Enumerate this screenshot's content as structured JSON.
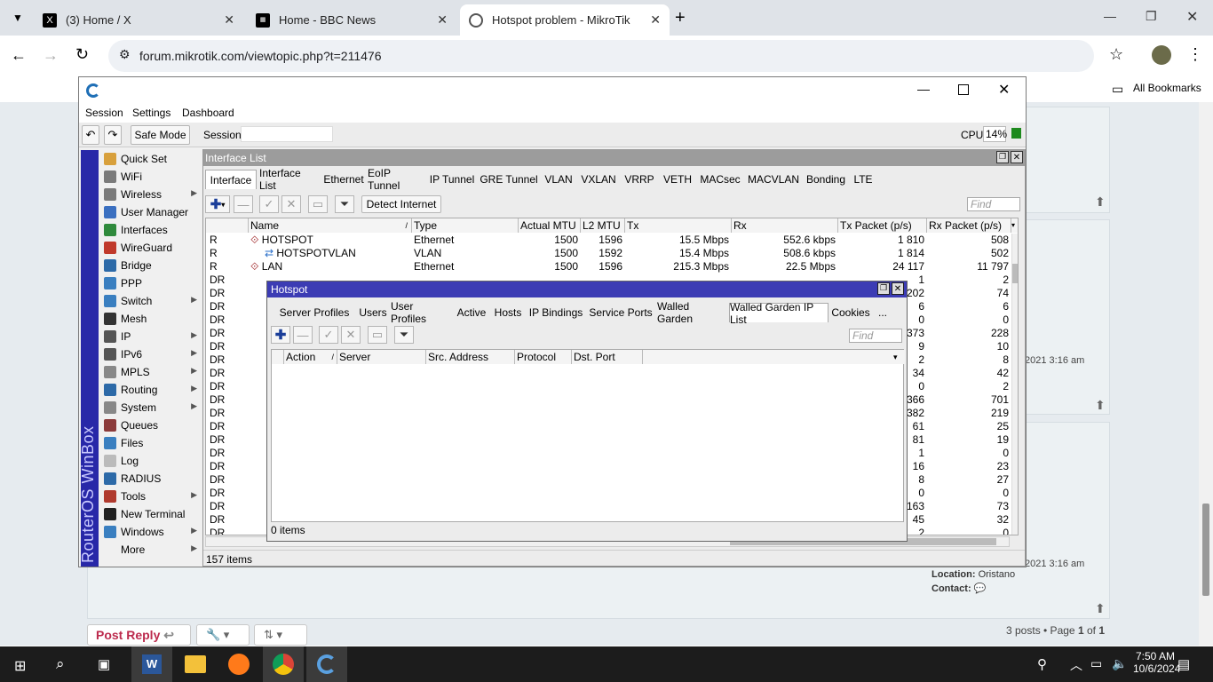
{
  "browser": {
    "tabs": [
      {
        "label": "(3) Home / X"
      },
      {
        "label": "Home - BBC News"
      },
      {
        "label": "Hotspot problem - MikroTik"
      }
    ],
    "url": "forum.mikrotik.com/viewtopic.php?t=211476",
    "all_bookmarks": "All Bookmarks"
  },
  "forum": {
    "timestamp1": "2021 3:16 am",
    "timestamp2": "2021 3:16 am",
    "location_label": "Location:",
    "location_value": "Oristano",
    "contact_label": "Contact:",
    "post_reply": "Post Reply",
    "pagination_prefix": "3 posts • Page",
    "page_current": "1",
    "page_of": "of",
    "page_total": "1"
  },
  "winbox": {
    "menu": [
      "Session",
      "Settings",
      "Dashboard"
    ],
    "safe_mode": "Safe Mode",
    "session_label": "Session:",
    "cpu_label": "CPU:",
    "cpu_value": "14%",
    "brand": "RouterOS WinBox",
    "sidebar": [
      {
        "label": "Quick Set",
        "arrow": false,
        "color": "#d8a03c"
      },
      {
        "label": "WiFi",
        "arrow": false,
        "color": "#7a7a7a"
      },
      {
        "label": "Wireless",
        "arrow": true,
        "color": "#7a7a7a"
      },
      {
        "label": "User Manager",
        "arrow": false,
        "color": "#3a6fc0"
      },
      {
        "label": "Interfaces",
        "arrow": false,
        "color": "#2f8a3c"
      },
      {
        "label": "WireGuard",
        "arrow": false,
        "color": "#c0392b"
      },
      {
        "label": "Bridge",
        "arrow": false,
        "color": "#2d6aa8"
      },
      {
        "label": "PPP",
        "arrow": false,
        "color": "#3a7fc0"
      },
      {
        "label": "Switch",
        "arrow": true,
        "color": "#3a7fc0"
      },
      {
        "label": "Mesh",
        "arrow": false,
        "color": "#333"
      },
      {
        "label": "IP",
        "arrow": true,
        "color": "#555"
      },
      {
        "label": "IPv6",
        "arrow": true,
        "color": "#555"
      },
      {
        "label": "MPLS",
        "arrow": true,
        "color": "#888"
      },
      {
        "label": "Routing",
        "arrow": true,
        "color": "#2d6aa8"
      },
      {
        "label": "System",
        "arrow": true,
        "color": "#888"
      },
      {
        "label": "Queues",
        "arrow": false,
        "color": "#8b3a3a"
      },
      {
        "label": "Files",
        "arrow": false,
        "color": "#3a7fc0"
      },
      {
        "label": "Log",
        "arrow": false,
        "color": "#bbb"
      },
      {
        "label": "RADIUS",
        "arrow": false,
        "color": "#2d6aa8"
      },
      {
        "label": "Tools",
        "arrow": true,
        "color": "#b03a2e"
      },
      {
        "label": "New Terminal",
        "arrow": false,
        "color": "#222"
      },
      {
        "label": "Windows",
        "arrow": true,
        "color": "#3a7fc0"
      },
      {
        "label": "More",
        "arrow": true,
        "color": ""
      }
    ]
  },
  "interface_list": {
    "title": "Interface List",
    "tabs": [
      "Interface",
      "Interface List",
      "Ethernet",
      "EoIP Tunnel",
      "IP Tunnel",
      "GRE Tunnel",
      "VLAN",
      "VXLAN",
      "VRRP",
      "VETH",
      "MACsec",
      "MACVLAN",
      "Bonding",
      "LTE"
    ],
    "detect_internet": "Detect Internet",
    "find_placeholder": "Find",
    "columns": [
      "Name",
      "Type",
      "Actual MTU",
      "L2 MTU",
      "Tx",
      "Rx",
      "Tx Packet (p/s)",
      "Rx Packet (p/s)"
    ],
    "rows": [
      {
        "flag": "R",
        "name": "HOTSPOT",
        "type": "Ethernet",
        "mtu": "1500",
        "l2mtu": "1596",
        "tx": "15.5 Mbps",
        "rx": "552.6 kbps",
        "txp": "1 810",
        "rxp": "508"
      },
      {
        "flag": "R",
        "name": "HOTSPOTVLAN",
        "type": "VLAN",
        "mtu": "1500",
        "l2mtu": "1592",
        "tx": "15.4 Mbps",
        "rx": "508.6 kbps",
        "txp": "1 814",
        "rxp": "502"
      },
      {
        "flag": "R",
        "name": "LAN",
        "type": "Ethernet",
        "mtu": "1500",
        "l2mtu": "1596",
        "tx": "215.3 Mbps",
        "rx": "22.5 Mbps",
        "txp": "24 117",
        "rxp": "11 797"
      },
      {
        "flag": "DR",
        "name": "",
        "type": "",
        "mtu": "",
        "l2mtu": "",
        "tx": "",
        "rx": "",
        "txp": "1",
        "rxp": "2"
      },
      {
        "flag": "DR",
        "name": "",
        "type": "",
        "mtu": "",
        "l2mtu": "",
        "tx": "",
        "rx": "",
        "txp": "202",
        "rxp": "74"
      },
      {
        "flag": "DR",
        "name": "",
        "type": "",
        "mtu": "",
        "l2mtu": "",
        "tx": "",
        "rx": "",
        "txp": "6",
        "rxp": "6"
      },
      {
        "flag": "DR",
        "name": "",
        "type": "",
        "mtu": "",
        "l2mtu": "",
        "tx": "",
        "rx": "",
        "txp": "0",
        "rxp": "0"
      },
      {
        "flag": "DR",
        "name": "",
        "type": "",
        "mtu": "",
        "l2mtu": "",
        "tx": "",
        "rx": "",
        "txp": "373",
        "rxp": "228"
      },
      {
        "flag": "DR",
        "name": "",
        "type": "",
        "mtu": "",
        "l2mtu": "",
        "tx": "",
        "rx": "",
        "txp": "9",
        "rxp": "10"
      },
      {
        "flag": "DR",
        "name": "",
        "type": "",
        "mtu": "",
        "l2mtu": "",
        "tx": "",
        "rx": "",
        "txp": "2",
        "rxp": "8"
      },
      {
        "flag": "DR",
        "name": "",
        "type": "",
        "mtu": "",
        "l2mtu": "",
        "tx": "",
        "rx": "",
        "txp": "34",
        "rxp": "42"
      },
      {
        "flag": "DR",
        "name": "",
        "type": "",
        "mtu": "",
        "l2mtu": "",
        "tx": "",
        "rx": "",
        "txp": "0",
        "rxp": "2"
      },
      {
        "flag": "DR",
        "name": "",
        "type": "",
        "mtu": "",
        "l2mtu": "",
        "tx": "",
        "rx": "",
        "txp": "366",
        "rxp": "701"
      },
      {
        "flag": "DR",
        "name": "",
        "type": "",
        "mtu": "",
        "l2mtu": "",
        "tx": "",
        "rx": "",
        "txp": "382",
        "rxp": "219"
      },
      {
        "flag": "DR",
        "name": "",
        "type": "",
        "mtu": "",
        "l2mtu": "",
        "tx": "",
        "rx": "",
        "txp": "61",
        "rxp": "25"
      },
      {
        "flag": "DR",
        "name": "",
        "type": "",
        "mtu": "",
        "l2mtu": "",
        "tx": "",
        "rx": "",
        "txp": "81",
        "rxp": "19"
      },
      {
        "flag": "DR",
        "name": "",
        "type": "",
        "mtu": "",
        "l2mtu": "",
        "tx": "",
        "rx": "",
        "txp": "1",
        "rxp": "0"
      },
      {
        "flag": "DR",
        "name": "",
        "type": "",
        "mtu": "",
        "l2mtu": "",
        "tx": "",
        "rx": "",
        "txp": "16",
        "rxp": "23"
      },
      {
        "flag": "DR",
        "name": "",
        "type": "",
        "mtu": "",
        "l2mtu": "",
        "tx": "",
        "rx": "",
        "txp": "8",
        "rxp": "27"
      },
      {
        "flag": "DR",
        "name": "",
        "type": "",
        "mtu": "",
        "l2mtu": "",
        "tx": "",
        "rx": "",
        "txp": "0",
        "rxp": "0"
      },
      {
        "flag": "DR",
        "name": "",
        "type": "",
        "mtu": "",
        "l2mtu": "",
        "tx": "",
        "rx": "",
        "txp": "163",
        "rxp": "73"
      },
      {
        "flag": "DR",
        "name": "",
        "type": "",
        "mtu": "",
        "l2mtu": "",
        "tx": "",
        "rx": "",
        "txp": "45",
        "rxp": "32"
      },
      {
        "flag": "DR",
        "name": "",
        "type": "",
        "mtu": "",
        "l2mtu": "",
        "tx": "",
        "rx": "",
        "txp": "2",
        "rxp": "0"
      }
    ],
    "item_count": "157 items"
  },
  "hotspot": {
    "title": "Hotspot",
    "tabs": [
      "Server Profiles",
      "Users",
      "User Profiles",
      "Active",
      "Hosts",
      "IP Bindings",
      "Service Ports",
      "Walled Garden",
      "Walled Garden IP List",
      "Cookies",
      "..."
    ],
    "find_placeholder": "Find",
    "columns": [
      "Action",
      "Server",
      "Src. Address",
      "Protocol",
      "Dst. Port"
    ],
    "item_count": "0 items"
  },
  "taskbar": {
    "time": "7:50 AM",
    "date": "10/6/2024"
  }
}
